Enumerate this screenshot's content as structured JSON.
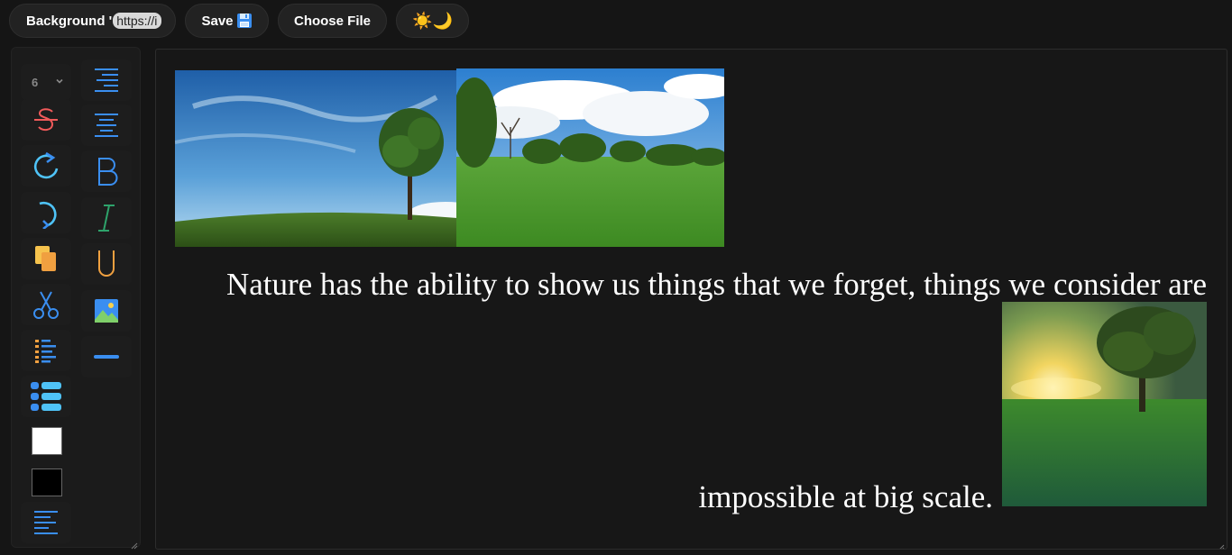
{
  "topbar": {
    "background_label": "Background '",
    "background_url_value": "https://images",
    "save_label": "Save",
    "choose_file_label": "Choose File",
    "theme_toggle_label": "☀️🌙"
  },
  "tools": {
    "font_size_value": "6",
    "text_color": "#ffffff",
    "highlight_color": "#000000",
    "icons": [
      "align-right-icon",
      "align-center-icon",
      "strikethrough-icon",
      "bold-icon",
      "redo-icon",
      "italic-icon",
      "undo-icon",
      "underline-icon",
      "copy-icon",
      "image-icon",
      "cut-icon",
      "horizontal-rule-icon",
      "ordered-list-icon",
      "unordered-list-icon",
      "align-left-icon"
    ]
  },
  "editor": {
    "paragraph_line1": "Nature has the ability to show us things that we forget, things we consider are",
    "paragraph_line2": "impossible at big scale.",
    "images": [
      "tree-on-hill-image",
      "green-park-field-image",
      "sunset-tree-field-image"
    ]
  },
  "colors": {
    "accent_blue": "#3a8ef0",
    "cyan": "#4fc3f7",
    "red": "#f05a5a",
    "green": "#2ea36b",
    "orange": "#f0a040",
    "background": "#151515"
  }
}
